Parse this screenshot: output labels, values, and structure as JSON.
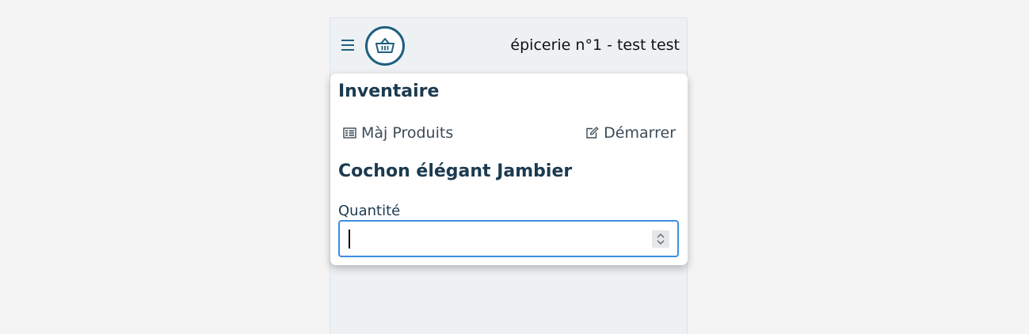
{
  "header": {
    "store_name": "épicerie n°1 - test test"
  },
  "inventory": {
    "title": "Inventaire",
    "update_products_label": "Màj Produits",
    "start_label": "Démarrer"
  },
  "product": {
    "name": "Cochon élégant Jambier"
  },
  "quantity": {
    "label": "Quantité",
    "value": ""
  },
  "colors": {
    "accent": "#1f5f7f",
    "heading": "#1b3a4f",
    "focus_border": "#3d8ee0"
  },
  "icons": {
    "menu": "hamburger-icon",
    "logo": "basket-icon",
    "update": "list-icon",
    "start": "edit-icon",
    "stepper": "chevron-up-down-icon"
  }
}
